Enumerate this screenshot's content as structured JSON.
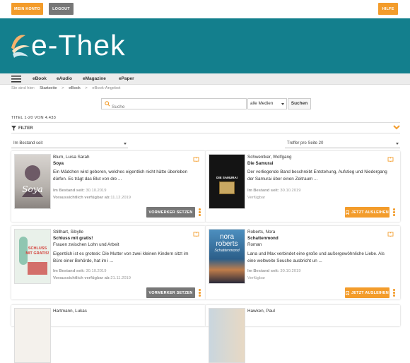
{
  "topbar": {
    "my_account": "MEIN KONTO",
    "logout": "LOGOUT",
    "help": "HILFE",
    "colors": {
      "orange": "#f39c2b",
      "gray": "#777777"
    }
  },
  "banner": {
    "logo": "e-Thek",
    "color": "#137f8d"
  },
  "nav": {
    "items": [
      "eBook",
      "eAudio",
      "eMagazine",
      "ePaper"
    ]
  },
  "breadcrumb": {
    "prefix": "Sie sind hier:",
    "items": [
      "Startseite",
      "eBook",
      "eBook-Angebot"
    ]
  },
  "search": {
    "placeholder": "Suche",
    "media": "alle Medien",
    "button": "Suchen"
  },
  "results": {
    "count": "TITEL 1-20 VON 4.433",
    "filter": "FILTER"
  },
  "sort": {
    "selected": "Im Bestand seit",
    "per_page": "Treffer pro Seite 20"
  },
  "cards": [
    {
      "author": "Blum, Luisa Sarah",
      "title": "Soya",
      "subtitle": "",
      "description": "Ein Mädchen wird geboren, welches eigentlich nicht hätte überleben dürfen. Es trägt das Blut von dre ...",
      "meta1_label": "Im Bestand seit:",
      "meta1_value": "30.10.2019",
      "meta2_label": "Voraussichtlich verfügbar ab:",
      "meta2_value": "11.12.2019",
      "action": "VORMERKER SETZEN",
      "action_type": "reserve"
    },
    {
      "author": "Schwentker, Wolfgang",
      "title": "Die Samurai",
      "subtitle": "",
      "description": "Der vorliegende Band beschreibt Entstehung, Aufstieg und Niedergang der Samurai über einen Zeitraum ...",
      "meta1_label": "Im Bestand seit:",
      "meta1_value": "30.10.2019",
      "meta2_label": "Verfügbar",
      "meta2_value": "",
      "action": "JETZT AUSLEIHEN",
      "action_type": "borrow"
    },
    {
      "author": "Stillhart, Sibylle",
      "title": "Schluss mit gratis!",
      "subtitle": "Frauen zwischen Lohn und Arbeit",
      "description": "Eigentlich ist es grotesk: Die Mutter von zwei kleinen Kindern sitzt im Büro einer Behörde, hat im i ...",
      "meta1_label": "Im Bestand seit:",
      "meta1_value": "30.10.2019",
      "meta2_label": "Voraussichtlich verfügbar ab:",
      "meta2_value": "21.11.2019",
      "action": "VORMERKER SETZEN",
      "action_type": "reserve"
    },
    {
      "author": "Roberts, Nora",
      "title": "Schattenmond",
      "subtitle": "Roman",
      "description": "Lana und Max verbindet eine große und außergewöhnliche Liebe. Als eine weltweite Seuche ausbricht un ...",
      "meta1_label": "Im Bestand seit:",
      "meta1_value": "30.10.2019",
      "meta2_label": "Verfügbar",
      "meta2_value": "",
      "action": "JETZT AUSLEIHEN",
      "action_type": "borrow"
    },
    {
      "author": "Hartmann, Lukas"
    },
    {
      "author": "Hawken, Paul"
    }
  ],
  "cover_text": {
    "soya": "Soya",
    "samurai": "DIE SAMURAI",
    "gratis": "SCHLUSS MIT GRATIS!",
    "nora1": "nora",
    "nora2": "roberts",
    "nora3": "Schattenmond"
  }
}
